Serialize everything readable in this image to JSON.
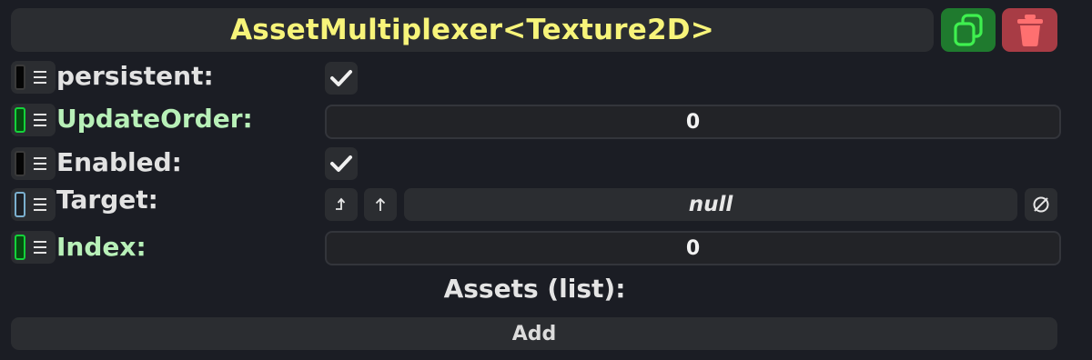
{
  "header": {
    "title": "AssetMultiplexer<Texture2D>",
    "copy_icon": "copy-icon",
    "delete_icon": "trash-icon",
    "copy_color": "#1f7a2e",
    "delete_color": "#a83c45",
    "title_color": "#f7f47a"
  },
  "fields": {
    "persistent": {
      "label": "persistent:",
      "checked": true
    },
    "update_order": {
      "label": "UpdateOrder:",
      "value": "0"
    },
    "enabled": {
      "label": "Enabled:",
      "checked": true
    },
    "target": {
      "label": "Target:",
      "value": "null",
      "jump_icon": "jump-to-icon",
      "up_icon": "up-arrow-icon",
      "clear_icon": "clear-null-icon"
    },
    "index": {
      "label": "Index:",
      "value": "0"
    }
  },
  "assets": {
    "label": "Assets (list):",
    "add_label": "Add"
  }
}
